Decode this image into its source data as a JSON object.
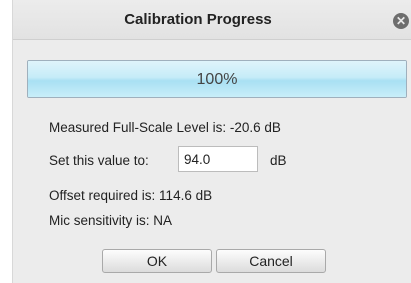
{
  "window": {
    "title": "Calibration Progress",
    "close_icon": "close-icon"
  },
  "progress": {
    "percent": 100,
    "label": "100%"
  },
  "measured_level": "Measured Full-Scale Level is: -20.6 dB",
  "set_value": {
    "label": "Set this value to:",
    "value": "94.0",
    "unit": "dB"
  },
  "offset_required": "Offset required is: 114.6 dB",
  "mic_sensitivity": "Mic sensitivity is: NA",
  "buttons": {
    "ok": "OK",
    "cancel": "Cancel"
  }
}
